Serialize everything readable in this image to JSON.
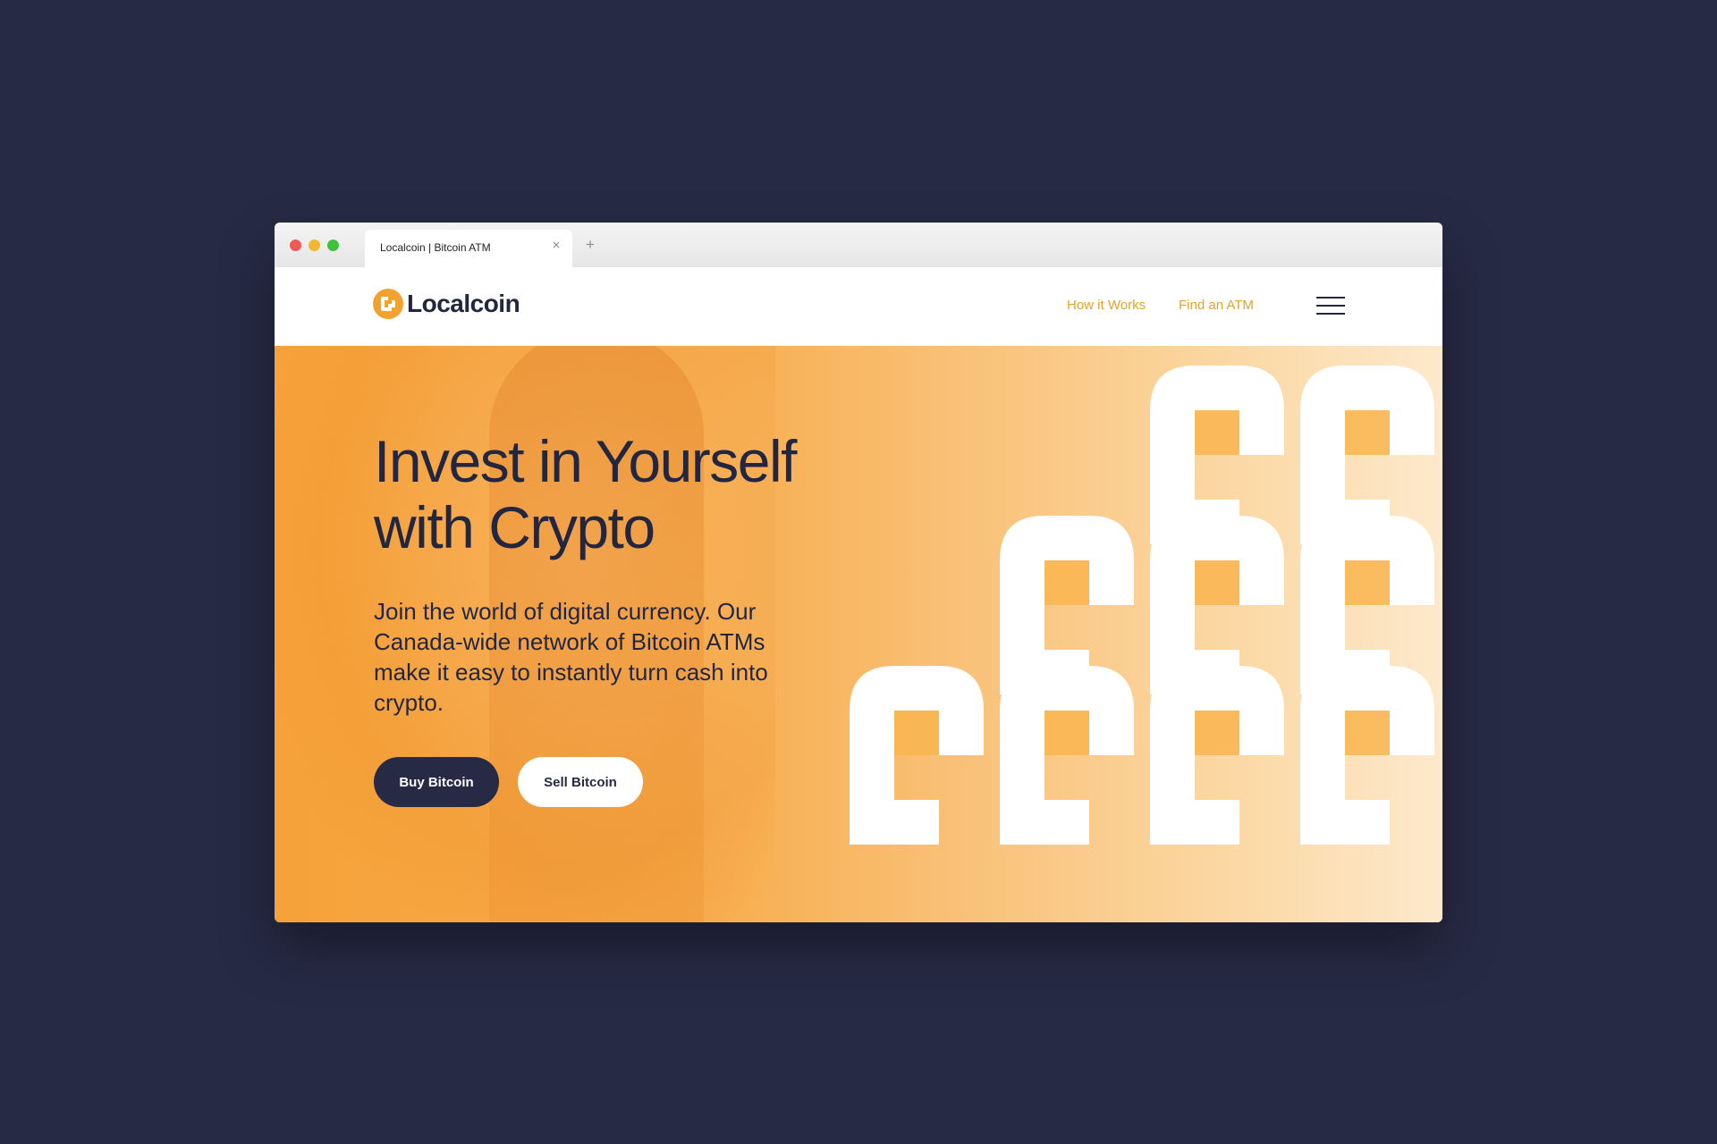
{
  "window": {
    "controls": [
      "close",
      "minimize",
      "maximize"
    ],
    "tab_title": "Localcoin | Bitcoin ATM",
    "tab_close_glyph": "×",
    "new_tab_glyph": "+"
  },
  "header": {
    "logo_text": "Localcoin",
    "logo_icon": "localcoin-logo-icon",
    "nav": [
      {
        "label": "How it Works"
      },
      {
        "label": "Find an ATM"
      }
    ],
    "menu_icon": "hamburger-menu-icon"
  },
  "hero": {
    "title": "Invest in Yourself with Crypto",
    "subtitle": "Join the world of digital currency. Our Canada-wide network of Bitcoin ATMs make it easy to instantly turn cash into crypto.",
    "buy_label": "Buy Bitcoin",
    "sell_label": "Sell Bitcoin"
  },
  "colors": {
    "background": "#262a45",
    "brand_orange": "#f6a23a",
    "nav_link": "#e8a02a",
    "dark_text": "#23263f"
  }
}
